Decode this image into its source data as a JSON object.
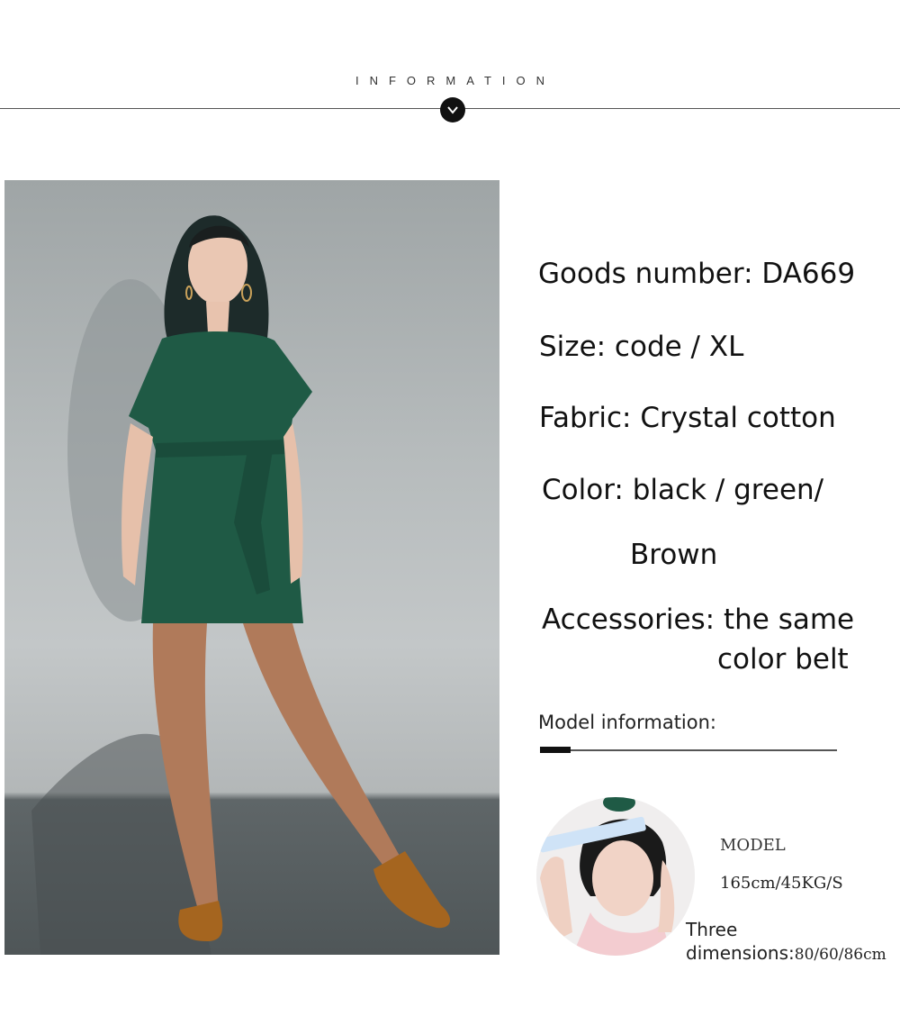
{
  "header": {
    "title": "INFORMATION"
  },
  "product": {
    "goods_number": "Goods number: DA669",
    "size": "Size: code / XL",
    "fabric": "Fabric: Crystal cotton",
    "color_line1": "Color: black / green/",
    "color_line2": "Brown",
    "accessories_line1": "Accessories: the same",
    "accessories_line2": "color belt"
  },
  "model": {
    "section_label": "Model information:",
    "title": "MODEL",
    "stats": "165cm/45KG/S",
    "three_dimensions_label_1": "Three",
    "three_dimensions_label_2": "dimensions:",
    "three_dimensions_value": "80/60/86cm"
  },
  "colors": {
    "dress_green": "#1f5a45",
    "shoe_bronze": "#a5651f",
    "background": "#ffffff"
  }
}
